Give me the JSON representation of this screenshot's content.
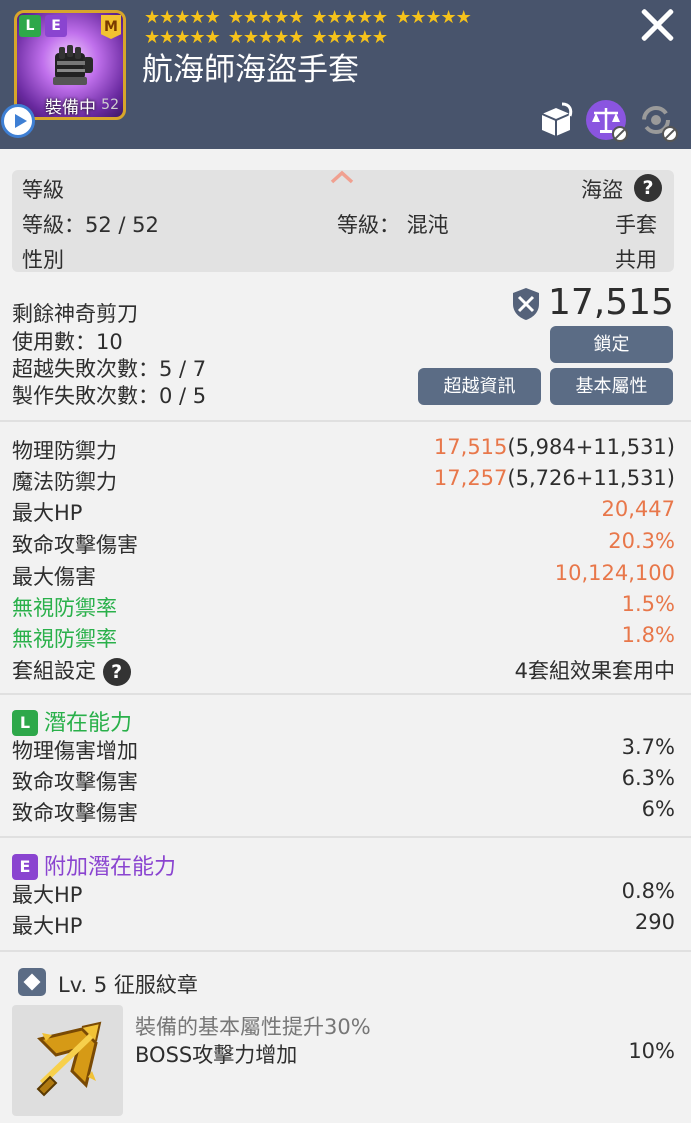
{
  "header": {
    "item_name": "航海師海盜手套",
    "grade_l": "L",
    "grade_e": "E",
    "m_badge": "M",
    "equipped": "裝備中",
    "level_small": "52",
    "star_groups": [
      "★★★★★",
      "★★★★★",
      "★★★★★",
      "★★★★★",
      "★★★★★",
      "★★★★★",
      "★★★★★"
    ]
  },
  "info": {
    "level_label": "等級",
    "job": "海盜",
    "level_value": "等級：52 / 52",
    "grade_value": "等級： 混沌",
    "slot": "手套",
    "gender_label": "性別",
    "gender_value": "共用",
    "help": "?"
  },
  "scissors": {
    "remaining": "剩餘神奇剪刀",
    "uses": "使用數：10",
    "transcend_fail": "超越失敗次數：5 / 7",
    "craft_fail": "製作失敗次數：0 / 5",
    "combat_power": "17,515",
    "lock_button": "鎖定",
    "transcend_info_button": "超越資訊",
    "base_stats_button": "基本屬性"
  },
  "stats": [
    {
      "label": "物理防禦力",
      "value": "17,515",
      "detail": "(5,984+11,531)",
      "label_color": "normal"
    },
    {
      "label": "魔法防禦力",
      "value": "17,257",
      "detail": "(5,726+11,531)",
      "label_color": "normal"
    },
    {
      "label": "最大HP",
      "value": "20,447",
      "detail": "",
      "label_color": "normal"
    },
    {
      "label": "致命攻擊傷害",
      "value": "20.3%",
      "detail": "",
      "label_color": "normal"
    },
    {
      "label": "最大傷害",
      "value": "10,124,100",
      "detail": "",
      "label_color": "normal"
    },
    {
      "label": "無視防禦率",
      "value": "1.5%",
      "detail": "",
      "label_color": "green"
    },
    {
      "label": "無視防禦率",
      "value": "1.8%",
      "detail": "",
      "label_color": "green"
    }
  ],
  "set": {
    "label": "套組設定",
    "value": "4套組效果套用中"
  },
  "potential": {
    "tag": "L",
    "title": "潛在能力",
    "lines": [
      {
        "label": "物理傷害增加",
        "value": "3.7%"
      },
      {
        "label": "致命攻擊傷害",
        "value": "6.3%"
      },
      {
        "label": "致命攻擊傷害",
        "value": "6%"
      }
    ]
  },
  "additional_potential": {
    "tag": "E",
    "title": "附加潛在能力",
    "lines": [
      {
        "label": "最大HP",
        "value": "0.8%"
      },
      {
        "label": "最大HP",
        "value": "290"
      }
    ]
  },
  "emblem": {
    "title": "Lv. 5 征服紋章",
    "desc": "裝備的基本屬性提升30%",
    "effect_label": "BOSS攻擊力增加",
    "effect_value": "10%"
  },
  "colors": {
    "header_bg": "#48546c",
    "button_bg": "#5b6c85",
    "orange_value": "#e8774a",
    "green_label": "#29b04a",
    "purple": "#8a44d0"
  }
}
